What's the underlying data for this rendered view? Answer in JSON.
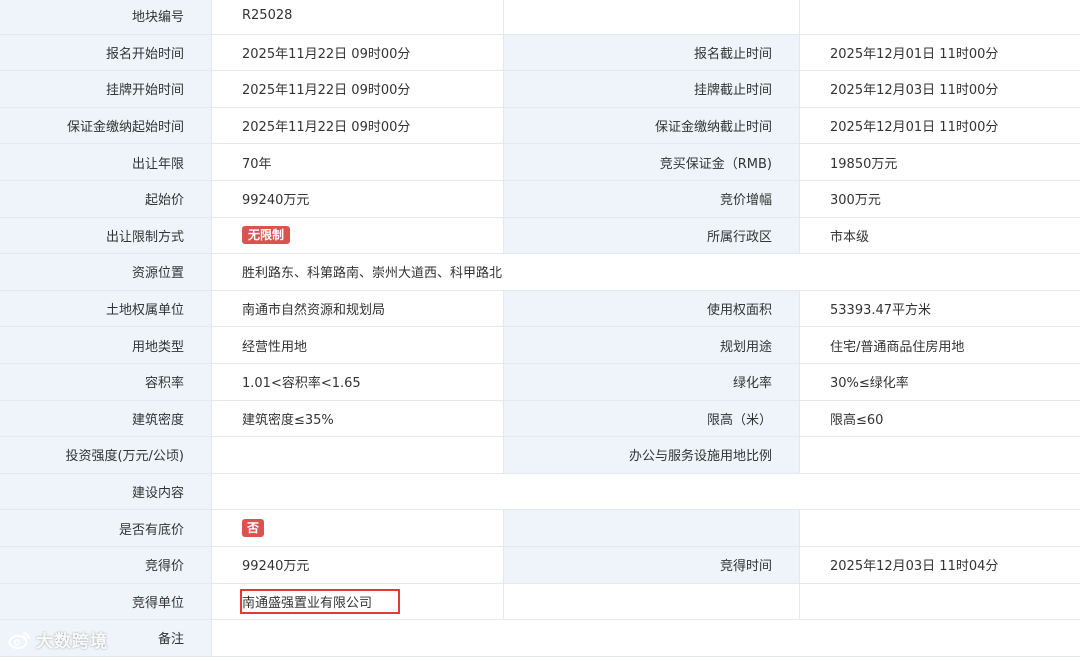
{
  "rows": [
    {
      "l1": "地块编号",
      "v1": "R25028",
      "l2": "",
      "v2": ""
    },
    {
      "l1": "报名开始时间",
      "v1": "2025年11月22日 09时00分",
      "l2": "报名截止时间",
      "v2": "2025年12月01日 11时00分"
    },
    {
      "l1": "挂牌开始时间",
      "v1": "2025年11月22日 09时00分",
      "l2": "挂牌截止时间",
      "v2": "2025年12月03日 11时00分"
    },
    {
      "l1": "保证金缴纳起始时间",
      "v1": "2025年11月22日 09时00分",
      "l2": "保证金缴纳截止时间",
      "v2": "2025年12月01日 11时00分"
    },
    {
      "l1": "出让年限",
      "v1": "70年",
      "l2": "竞买保证金（RMB)",
      "v2": "19850万元"
    },
    {
      "l1": "起始价",
      "v1": "99240万元",
      "l2": "竞价增幅",
      "v2": "300万元"
    },
    {
      "l1": "出让限制方式",
      "v1": "无限制",
      "l2": "所属行政区",
      "v2": "市本级"
    },
    {
      "l1": "资源位置",
      "v1": "胜利路东、科第路南、崇州大道西、科甲路北"
    },
    {
      "l1": "土地权属单位",
      "v1": "南通市自然资源和规划局",
      "l2": "使用权面积",
      "v2": "53393.47平方米"
    },
    {
      "l1": "用地类型",
      "v1": "经营性用地",
      "l2": "规划用途",
      "v2": "住宅/普通商品住房用地"
    },
    {
      "l1": "容积率",
      "v1": "1.01<容积率<1.65",
      "l2": "绿化率",
      "v2": "30%≤绿化率"
    },
    {
      "l1": "建筑密度",
      "v1": "建筑密度≤35%",
      "l2": "限高（米）",
      "v2": "限高≤60"
    },
    {
      "l1": "投资强度(万元/公顷)",
      "v1": "",
      "l2": "办公与服务设施用地比例",
      "v2": ""
    },
    {
      "l1": "建设内容",
      "v1": ""
    },
    {
      "l1": "是否有底价",
      "v1": "否",
      "l2": "",
      "v2": ""
    },
    {
      "l1": "竞得价",
      "v1": "99240万元",
      "l2": "竞得时间",
      "v2": "2025年12月03日 11时04分"
    },
    {
      "l1": "竞得单位",
      "v1": "南通盛强置业有限公司",
      "l2": "",
      "v2": ""
    },
    {
      "l1": "备注",
      "v1": ""
    }
  ],
  "colors": {
    "label_bg": "#eef4f9",
    "value_bg": "#ffffff",
    "border": "#e3e9ef",
    "tag_red": "#d9534f",
    "highlight_box": "#e53935"
  },
  "watermark": {
    "text": "大数跨境",
    "icon": "weibo-logo-icon"
  }
}
